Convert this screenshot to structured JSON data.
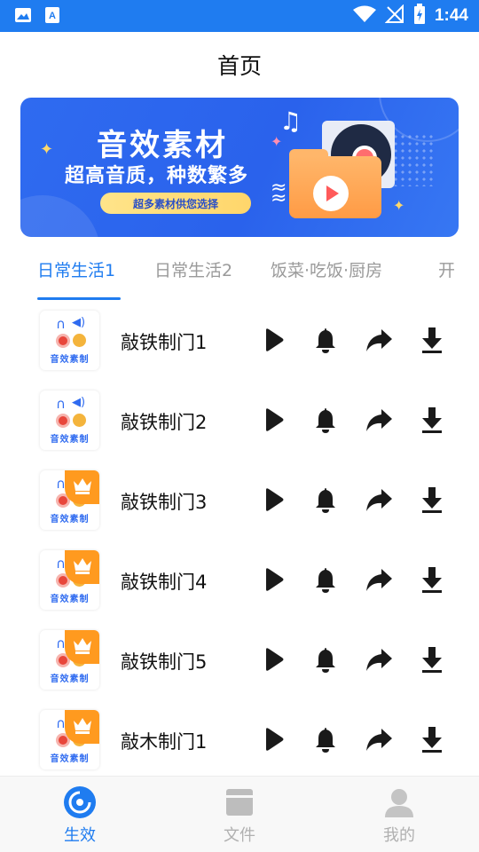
{
  "status_bar": {
    "time": "1:44",
    "icons": [
      "image-icon",
      "text-a-icon",
      "wifi-icon",
      "no-signal-icon",
      "battery-charging-icon"
    ]
  },
  "header": {
    "title": "首页"
  },
  "banner": {
    "title": "音效素材",
    "subtitle": "超高音质，种数繁多",
    "pill": "超多素材供您选择"
  },
  "tabs": [
    {
      "label": "日常生活1",
      "active": true
    },
    {
      "label": "日常生活2",
      "active": false
    },
    {
      "label": "饭菜·吃饭·厨房",
      "active": false
    },
    {
      "label": "开",
      "active": false
    }
  ],
  "thumbnail_text": "音效素制",
  "items": [
    {
      "title": "敲铁制门1",
      "vip": false
    },
    {
      "title": "敲铁制门2",
      "vip": false
    },
    {
      "title": "敲铁制门3",
      "vip": true
    },
    {
      "title": "敲铁制门4",
      "vip": true
    },
    {
      "title": "敲铁制门5",
      "vip": true
    },
    {
      "title": "敲木制门1",
      "vip": true
    }
  ],
  "actions": [
    "play-icon",
    "bell-icon",
    "share-icon",
    "download-icon"
  ],
  "bottom_nav": [
    {
      "label": "生效",
      "icon": "music-disc-icon",
      "active": true
    },
    {
      "label": "文件",
      "icon": "folder-icon",
      "active": false
    },
    {
      "label": "我的",
      "icon": "person-icon",
      "active": false
    }
  ],
  "colors": {
    "accent": "#1f7cf0",
    "banner": "#2f6bf0",
    "vip_badge": "#ff9a1f"
  }
}
